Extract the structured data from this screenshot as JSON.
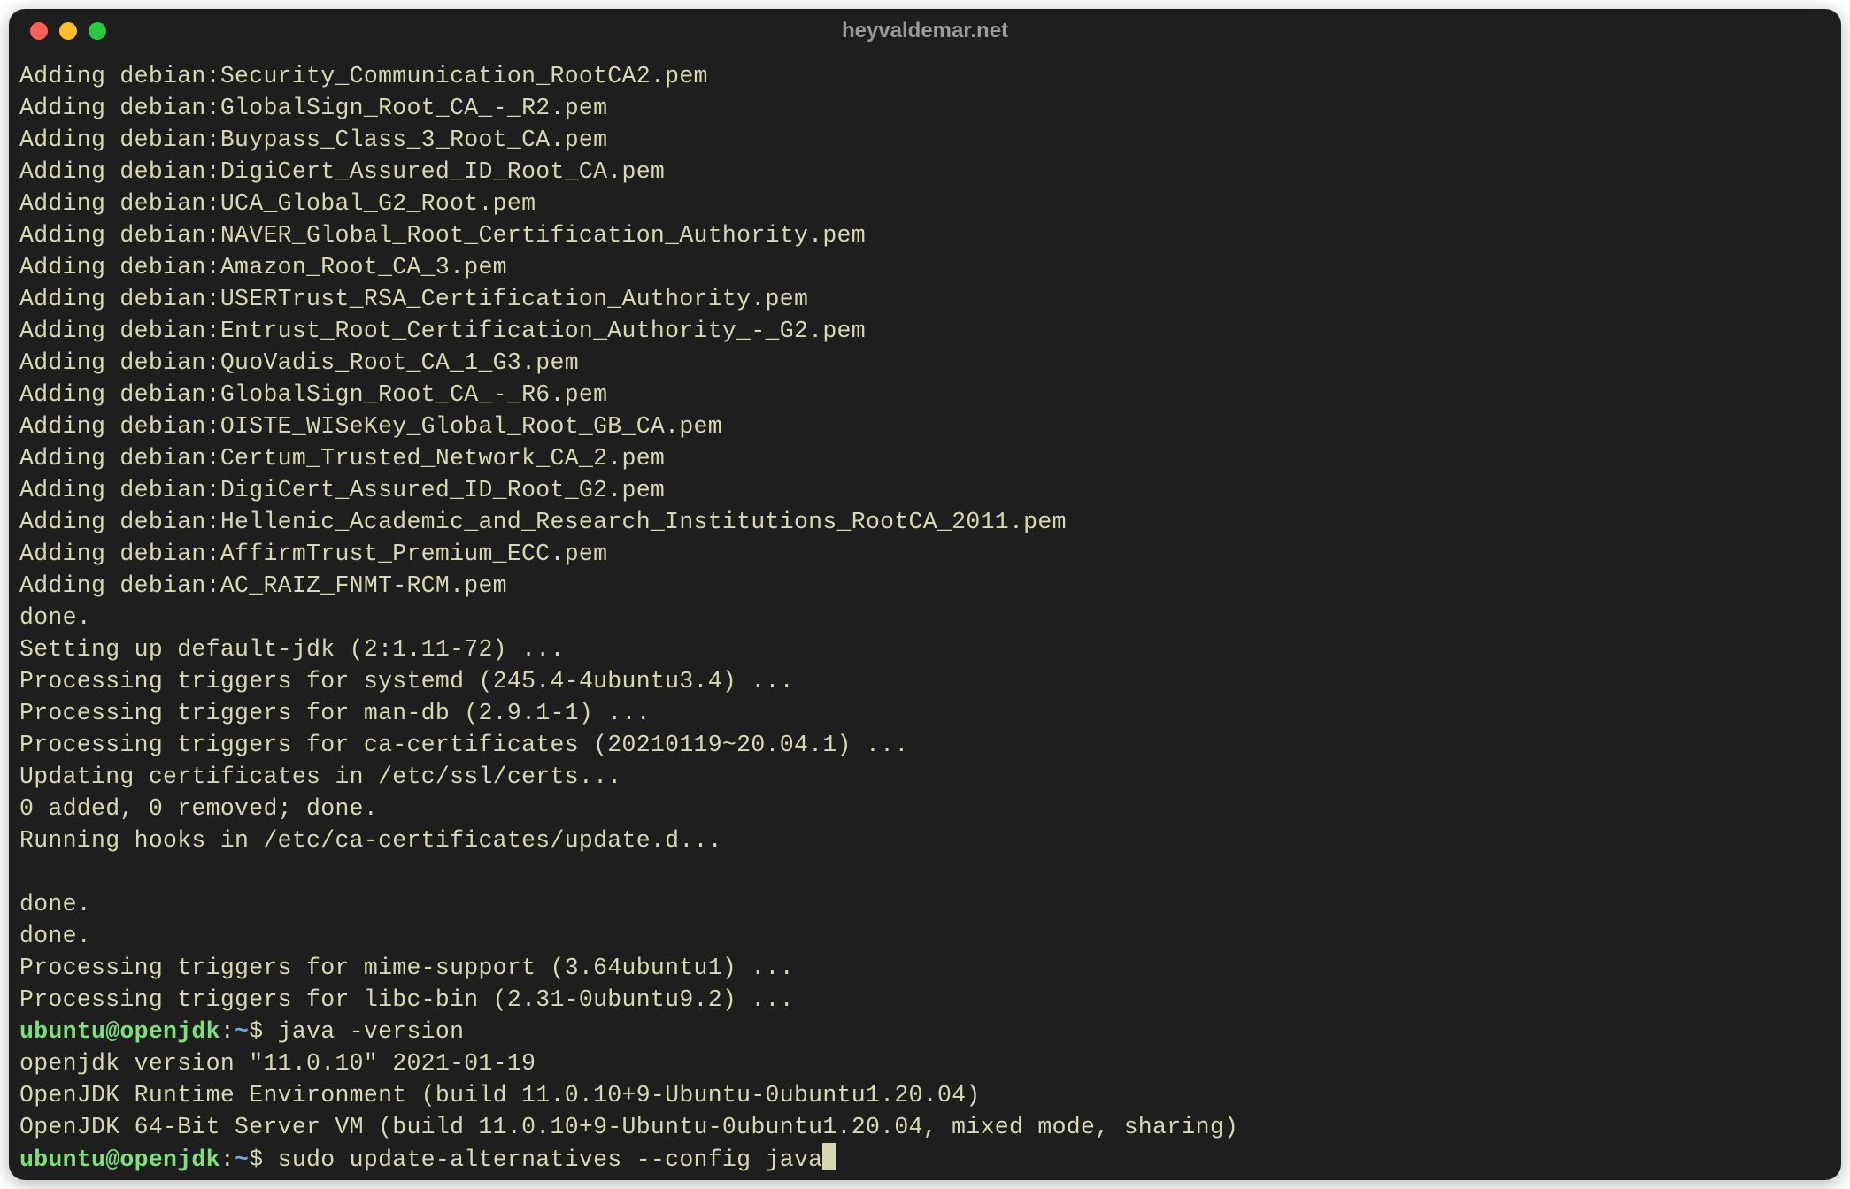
{
  "window": {
    "title": "heyvaldemar.net"
  },
  "output_lines": [
    "Adding debian:Security_Communication_RootCA2.pem",
    "Adding debian:GlobalSign_Root_CA_-_R2.pem",
    "Adding debian:Buypass_Class_3_Root_CA.pem",
    "Adding debian:DigiCert_Assured_ID_Root_CA.pem",
    "Adding debian:UCA_Global_G2_Root.pem",
    "Adding debian:NAVER_Global_Root_Certification_Authority.pem",
    "Adding debian:Amazon_Root_CA_3.pem",
    "Adding debian:USERTrust_RSA_Certification_Authority.pem",
    "Adding debian:Entrust_Root_Certification_Authority_-_G2.pem",
    "Adding debian:QuoVadis_Root_CA_1_G3.pem",
    "Adding debian:GlobalSign_Root_CA_-_R6.pem",
    "Adding debian:OISTE_WISeKey_Global_Root_GB_CA.pem",
    "Adding debian:Certum_Trusted_Network_CA_2.pem",
    "Adding debian:DigiCert_Assured_ID_Root_G2.pem",
    "Adding debian:Hellenic_Academic_and_Research_Institutions_RootCA_2011.pem",
    "Adding debian:AffirmTrust_Premium_ECC.pem",
    "Adding debian:AC_RAIZ_FNMT-RCM.pem",
    "done.",
    "Setting up default-jdk (2:1.11-72) ...",
    "Processing triggers for systemd (245.4-4ubuntu3.4) ...",
    "Processing triggers for man-db (2.9.1-1) ...",
    "Processing triggers for ca-certificates (20210119~20.04.1) ...",
    "Updating certificates in /etc/ssl/certs...",
    "0 added, 0 removed; done.",
    "Running hooks in /etc/ca-certificates/update.d...",
    "",
    "done.",
    "done.",
    "Processing triggers for mime-support (3.64ubuntu1) ...",
    "Processing triggers for libc-bin (2.31-0ubuntu9.2) ..."
  ],
  "prompts": [
    {
      "user": "ubuntu",
      "at": "@",
      "host": "openjdk",
      "colon": ":",
      "path": "~",
      "dollar": "$ ",
      "command": "java -version",
      "has_cursor": false
    }
  ],
  "java_version_output": [
    "openjdk version \"11.0.10\" 2021-01-19",
    "OpenJDK Runtime Environment (build 11.0.10+9-Ubuntu-0ubuntu1.20.04)",
    "OpenJDK 64-Bit Server VM (build 11.0.10+9-Ubuntu-0ubuntu1.20.04, mixed mode, sharing)"
  ],
  "final_prompt": {
    "user": "ubuntu",
    "at": "@",
    "host": "openjdk",
    "colon": ":",
    "path": "~",
    "dollar": "$ ",
    "command": "sudo update-alternatives --config java",
    "has_cursor": true
  }
}
